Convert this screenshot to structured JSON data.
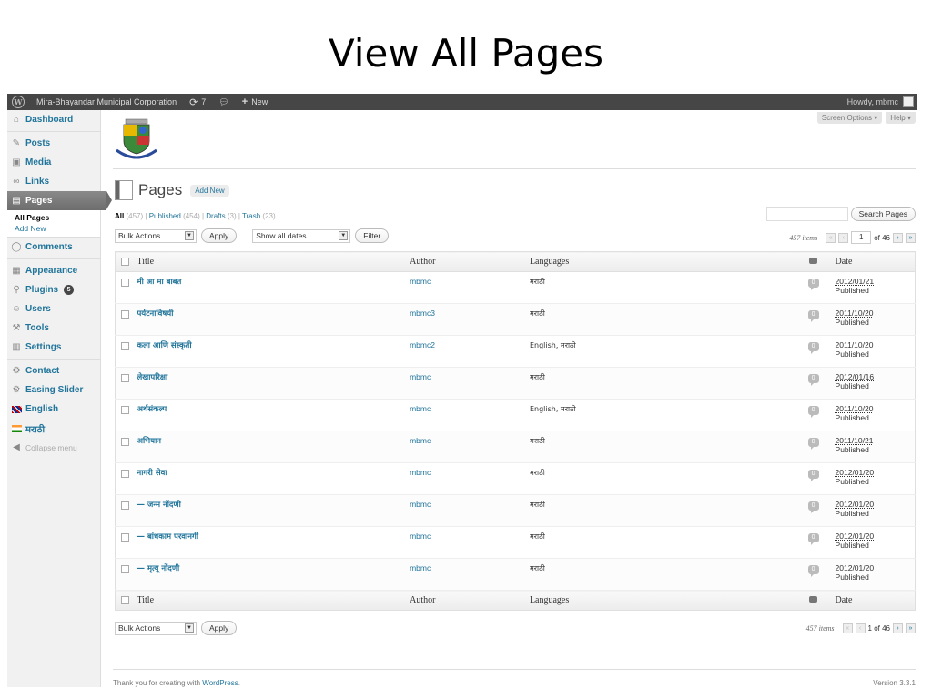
{
  "slide": {
    "title": "View All Pages"
  },
  "adminbar": {
    "site_name": "Mira-Bhayandar Municipal Corporation",
    "updates_count": "7",
    "new_label": "New",
    "howdy": "Howdy, mbmc"
  },
  "sidebar": {
    "items": [
      {
        "label": "Dashboard",
        "icon": "dashboard-icon"
      },
      {
        "label": "Posts",
        "icon": "pushpin-icon"
      },
      {
        "label": "Media",
        "icon": "media-icon"
      },
      {
        "label": "Links",
        "icon": "links-icon"
      },
      {
        "label": "Pages",
        "icon": "pages-icon"
      },
      {
        "label": "Comments",
        "icon": "comments-icon"
      },
      {
        "label": "Appearance",
        "icon": "appearance-icon"
      },
      {
        "label": "Plugins",
        "icon": "plugins-icon",
        "badge": "5"
      },
      {
        "label": "Users",
        "icon": "users-icon"
      },
      {
        "label": "Tools",
        "icon": "tools-icon"
      },
      {
        "label": "Settings",
        "icon": "settings-icon"
      },
      {
        "label": "Contact",
        "icon": "contact-icon"
      },
      {
        "label": "Easing Slider",
        "icon": "slider-icon"
      },
      {
        "label": "English",
        "icon": "uk-flag-icon"
      },
      {
        "label": "मराठी",
        "icon": "india-flag-icon"
      }
    ],
    "pages_submenu": [
      "All Pages",
      "Add New"
    ],
    "collapse": "Collapse menu"
  },
  "header": {
    "screen_options": "Screen Options ▾",
    "help": "Help ▾",
    "page_title": "Pages",
    "add_new": "Add New"
  },
  "filters": {
    "all": "All",
    "all_count": "(457)",
    "published": "Published",
    "published_count": "(454)",
    "drafts": "Drafts",
    "drafts_count": "(3)",
    "trash": "Trash",
    "trash_count": "(23)"
  },
  "search": {
    "button": "Search Pages"
  },
  "tablenav": {
    "bulk_actions": "Bulk Actions",
    "apply": "Apply",
    "dates": "Show all dates",
    "filter": "Filter",
    "items": "457 items",
    "page": "1",
    "of_pages": "of 46",
    "bottom_pages": "1 of 46"
  },
  "table": {
    "columns": [
      "Title",
      "Author",
      "Languages",
      "Date"
    ],
    "rows": [
      {
        "title": "मी आ मा बाबत",
        "author": "mbmc",
        "languages": "मराठी",
        "comments": "0",
        "date": "2012/01/21",
        "status": "Published"
      },
      {
        "title": "पर्यटनाविषयी",
        "author": "mbmc3",
        "languages": "मराठी",
        "comments": "0",
        "date": "2011/10/20",
        "status": "Published"
      },
      {
        "title": "कला आणि संस्कृती",
        "author": "mbmc2",
        "languages": "English, मराठी",
        "comments": "0",
        "date": "2011/10/20",
        "status": "Published"
      },
      {
        "title": "लेखापरिक्षा",
        "author": "mbmc",
        "languages": "मराठी",
        "comments": "0",
        "date": "2012/01/16",
        "status": "Published"
      },
      {
        "title": "अर्थसंकल्प",
        "author": "mbmc",
        "languages": "English, मराठी",
        "comments": "0",
        "date": "2011/10/20",
        "status": "Published"
      },
      {
        "title": "अभियान",
        "author": "mbmc",
        "languages": "मराठी",
        "comments": "0",
        "date": "2011/10/21",
        "status": "Published"
      },
      {
        "title": "नागरी सेवा",
        "author": "mbmc",
        "languages": "मराठी",
        "comments": "0",
        "date": "2012/01/20",
        "status": "Published"
      },
      {
        "title": "— जन्म नोंदणी",
        "author": "mbmc",
        "languages": "मराठी",
        "comments": "0",
        "date": "2012/01/20",
        "status": "Published"
      },
      {
        "title": "— बांधकाम परवानगी",
        "author": "mbmc",
        "languages": "मराठी",
        "comments": "0",
        "date": "2012/01/20",
        "status": "Published"
      },
      {
        "title": "— मृत्यू नोंदणी",
        "author": "mbmc",
        "languages": "मराठी",
        "comments": "0",
        "date": "2012/01/20",
        "status": "Published"
      }
    ]
  },
  "footer": {
    "thanks_prefix": "Thank you for creating with",
    "thanks_link": "WordPress",
    "thanks_suffix": ".",
    "version": "Version 3.3.1"
  }
}
